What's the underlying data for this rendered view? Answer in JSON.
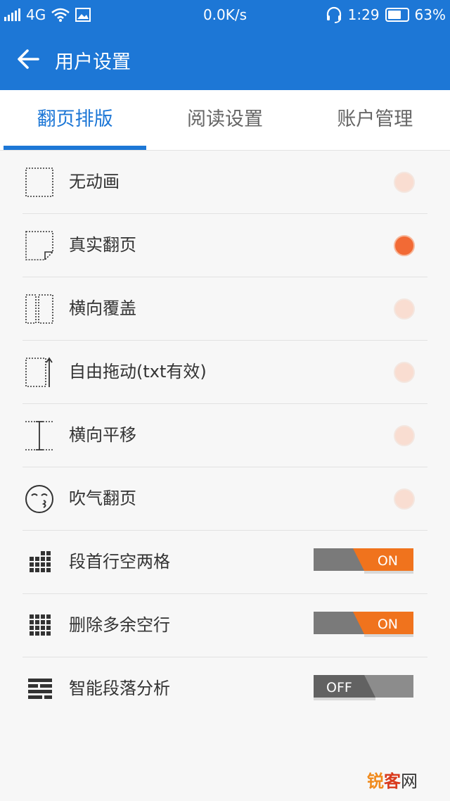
{
  "status_bar": {
    "network": "4G",
    "speed": "0.0K/s",
    "time": "1:29",
    "battery": "63%"
  },
  "app_bar": {
    "title": "用户设置",
    "back_icon": "arrow-left-icon"
  },
  "tabs": [
    {
      "label": "翻页排版",
      "active": true
    },
    {
      "label": "阅读设置",
      "active": false
    },
    {
      "label": "账户管理",
      "active": false
    }
  ],
  "page_modes": [
    {
      "label": "无动画",
      "icon": "no-animation-icon",
      "selected": false
    },
    {
      "label": "真实翻页",
      "icon": "page-curl-icon",
      "selected": true
    },
    {
      "label": "横向覆盖",
      "icon": "horizontal-cover-icon",
      "selected": false
    },
    {
      "label": "自由拖动(txt有效)",
      "icon": "free-drag-icon",
      "selected": false
    },
    {
      "label": "横向平移",
      "icon": "horizontal-shift-icon",
      "selected": false
    },
    {
      "label": "吹气翻页",
      "icon": "blow-face-icon",
      "selected": false
    }
  ],
  "toggles": [
    {
      "label": "段首行空两格",
      "icon": "indent-grid-icon",
      "state": "ON"
    },
    {
      "label": "删除多余空行",
      "icon": "grid-icon",
      "state": "ON"
    },
    {
      "label": "智能段落分析",
      "icon": "paragraph-icon",
      "state": "OFF"
    }
  ],
  "colors": {
    "primary": "#1d77d6",
    "accent": "#f26a35",
    "toggle_on": "#f0731d",
    "toggle_off": "#777777"
  },
  "watermark": {
    "part1": "锐",
    "part2": "客",
    "part3": "网"
  }
}
